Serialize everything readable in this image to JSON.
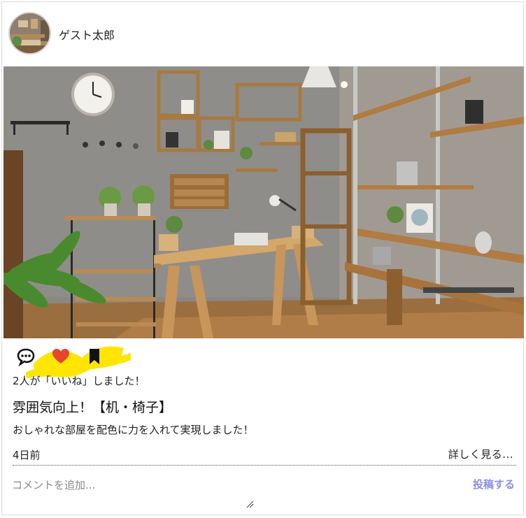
{
  "user": {
    "name": "ゲスト太郎",
    "avatar_icon": "room-photo-avatar"
  },
  "post": {
    "image_alt_icon": "room-interior-photo",
    "likes_text": "2人が「いいね」しました！",
    "title": "雰囲気向上！【机・椅子】",
    "description": "おしゃれな部屋を配色に力を入れて実現しました！",
    "time_ago": "4日前",
    "more_label": "詳しく見る..."
  },
  "actions": {
    "comment_icon": "comment-icon",
    "like_icon": "heart-icon",
    "bookmark_icon": "bookmark-icon",
    "like_color": "#e8452c",
    "highlight_color": "#ffe500"
  },
  "comment": {
    "placeholder": "コメントを追加...",
    "post_label": "投稿する",
    "post_color": "#8b8fe3"
  }
}
